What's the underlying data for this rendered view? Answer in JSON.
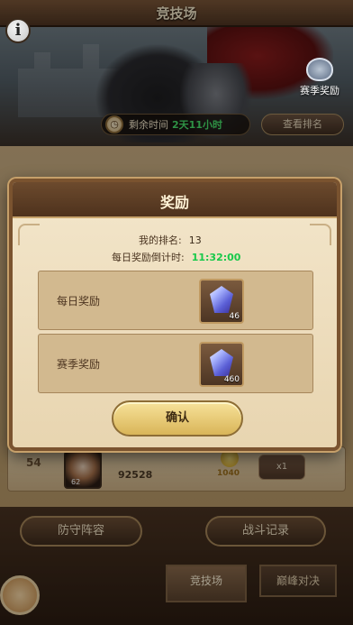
{
  "header": {
    "title": "竞技场"
  },
  "banner": {
    "season_reward_label": "赛季奖励"
  },
  "timer": {
    "label": "剩余时间",
    "value": "2天11小时"
  },
  "view_rank_label": "查看排名",
  "rank_row": {
    "rank": "54",
    "level": "62",
    "power": "92528",
    "points": "1040",
    "fight_label": "x1"
  },
  "buttons": {
    "defense": "防守阵容",
    "record": "战斗记录"
  },
  "tabs": {
    "arena": "竞技场",
    "peak": "巅峰对决"
  },
  "modal": {
    "title": "奖励",
    "rank_label": "我的排名:",
    "rank_value": "13",
    "countdown_label": "每日奖励倒计时:",
    "countdown_value": "11:32:00",
    "daily_label": "每日奖励",
    "daily_qty": "46",
    "season_label": "赛季奖励",
    "season_qty": "460",
    "confirm_label": "确认"
  },
  "colors": {
    "countdown": "#18c94a",
    "timer_value": "#48e06a",
    "panel": "#e8d5b0",
    "header": "#4e321d"
  }
}
